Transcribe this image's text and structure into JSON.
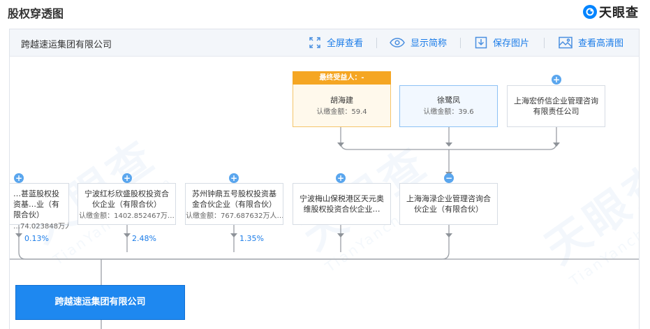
{
  "page": {
    "title": "股权穿透图"
  },
  "brand": {
    "name": "天眼查"
  },
  "toolbar": {
    "company": "跨越速运集团有限公司",
    "fullscreen_label": "全屏查看",
    "brief_label": "显示简称",
    "save_label": "保存图片",
    "hd_label": "查看高清图"
  },
  "watermark": {
    "text": "天眼查",
    "sub": "TianYancha.com"
  },
  "top_nodes": [
    {
      "badge": "最终受益人：-",
      "name": "胡海建",
      "amount": "认缴金额：59.4"
    },
    {
      "name": "徐鹭凤",
      "amount": "认缴金额：39.6"
    },
    {
      "name": "上海宏侨信企业管理咨询有限责任公司"
    }
  ],
  "mid_nodes": [
    {
      "name": "…甚蓝股权投资基…业（有限合伙）",
      "amount": "…74.023848万人…"
    },
    {
      "name": "宁波红杉欣盛股权投资合伙企业（有限合伙）",
      "amount": "认缴金额：1402.852467万…"
    },
    {
      "name": "苏州钟鼎五号股权投资基金合伙企业（有限合伙）",
      "amount": "认缴金额：767.687632万人…"
    },
    {
      "name": "宁波梅山保税港区天元奥维股权投资合伙企业…"
    },
    {
      "name": "上海海渌企业管理咨询合伙企业（有限合伙）"
    }
  ],
  "percentages": [
    "0.13%",
    "2.48%",
    "1.35%"
  ],
  "expand_symbol": "+",
  "collapse_symbol": "−",
  "main_company": "跨越速运集团有限公司"
}
